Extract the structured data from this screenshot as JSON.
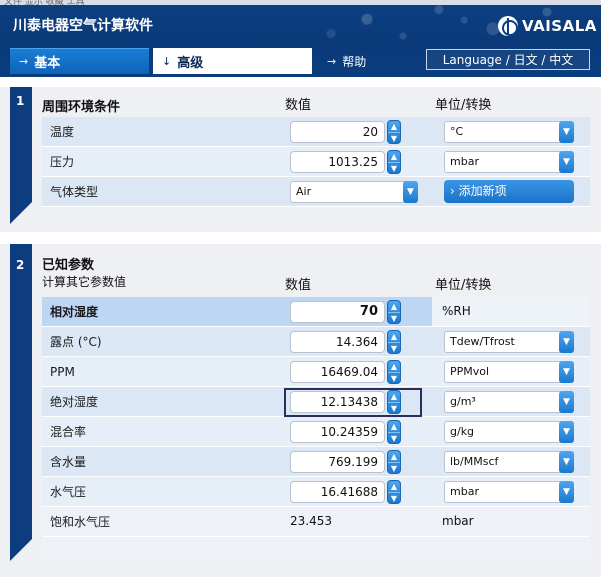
{
  "app": {
    "title": "川泰电器空气计算软件",
    "brand": "VAISALA",
    "top_strip": "文件   显示   收藏   工具"
  },
  "tabs": [
    {
      "label": "基本",
      "arrow": "→"
    },
    {
      "label": "高级",
      "arrow": "↓"
    },
    {
      "label": "帮助",
      "arrow": "→"
    }
  ],
  "language_button": "Language / 日文 / 中文",
  "section1": {
    "number": "1",
    "title": "周围环境条件",
    "col_value": "数值",
    "col_unit": "单位/转换",
    "rows": [
      {
        "label": "温度",
        "value": "20",
        "unit": "°C"
      },
      {
        "label": "压力",
        "value": "1013.25",
        "unit": "mbar"
      },
      {
        "label": "气体类型",
        "value": "Air"
      }
    ],
    "add_button": "添加新项",
    "add_icon": "chevron-right-icon"
  },
  "section2": {
    "number": "2",
    "title": "已知参数",
    "subtitle": "计算其它参数值",
    "col_value": "数值",
    "col_unit": "单位/转换",
    "rows": [
      {
        "label": "相对湿度",
        "value": "70",
        "unit": "%RH"
      },
      {
        "label": "露点 (°C)",
        "value": "14.364",
        "unit": "Tdew/Tfrost"
      },
      {
        "label": "PPM",
        "value": "16469.04",
        "unit": "PPMvol"
      },
      {
        "label": "绝对湿度",
        "value": "12.13438",
        "unit": "g/m³"
      },
      {
        "label": "混合率",
        "value": "10.24359",
        "unit": "g/kg"
      },
      {
        "label": "含水量",
        "value": "769.199",
        "unit": "lb/MMscf"
      },
      {
        "label": "水气压",
        "value": "16.41688",
        "unit": "mbar"
      },
      {
        "label": "饱和水气压",
        "value": "23.453",
        "unit": "mbar"
      }
    ]
  },
  "icons": {
    "spinner_up": "▲",
    "spinner_down": "▼",
    "dropdown": "▼"
  },
  "colors": {
    "header": "#0c3f82",
    "accent": "#1a7ed4",
    "row": "#dbe7f4",
    "active_row": "#bcd6f3"
  }
}
